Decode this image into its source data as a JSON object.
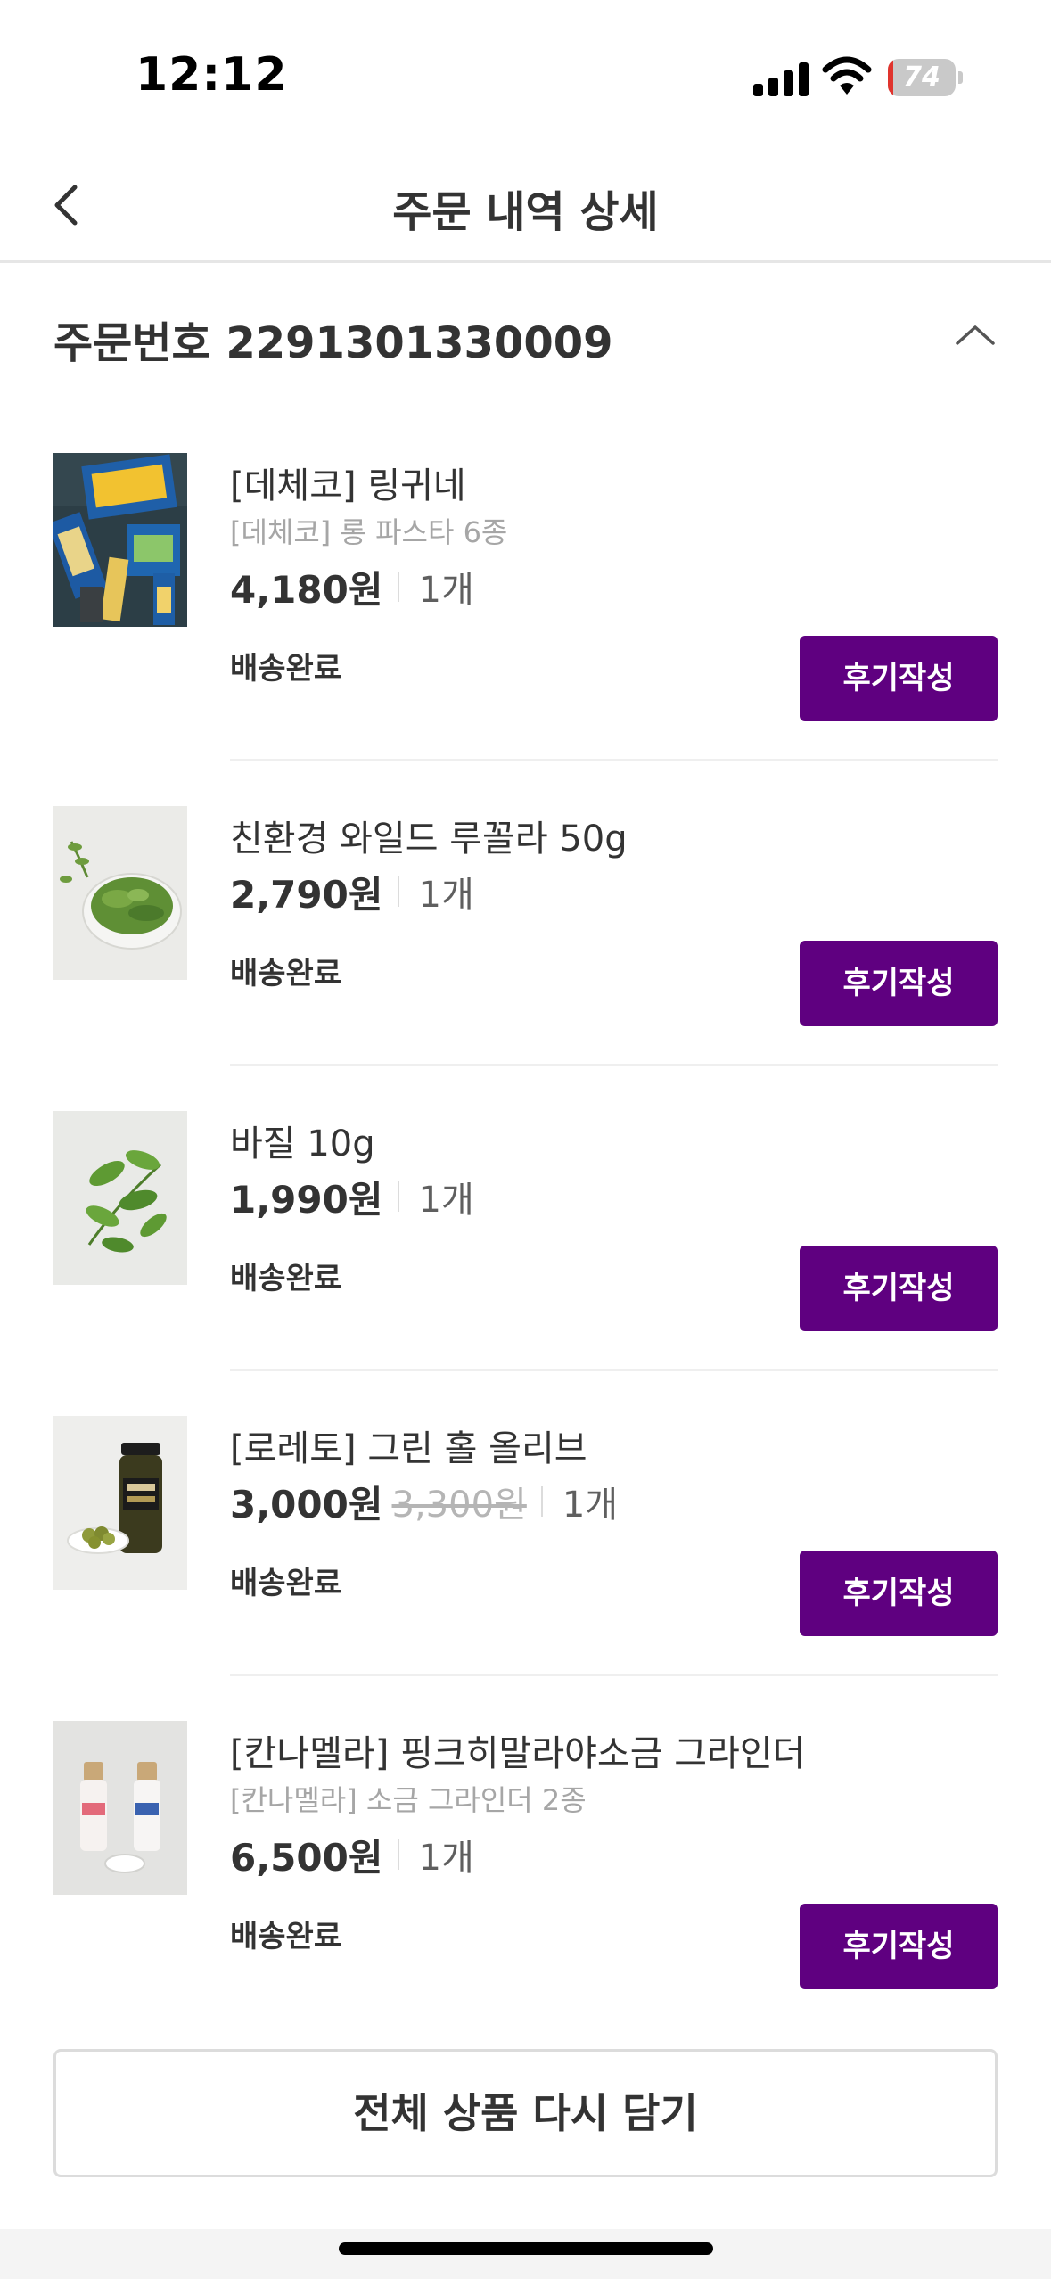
{
  "status_bar": {
    "time": "12:12",
    "battery_level": "74"
  },
  "nav": {
    "title": "주문 내역 상세"
  },
  "order": {
    "label": "주문번호 2291301330009"
  },
  "items": [
    {
      "name": "[데체코] 링귀네",
      "subtitle": "[데체코] 롱 파스타 6종",
      "price": "4,180원",
      "original_price": "",
      "qty": "1개",
      "status": "배송완료",
      "button": "후기작성",
      "thumb": "pasta-thumbnail"
    },
    {
      "name": "친환경 와일드 루꼴라 50g",
      "subtitle": "",
      "price": "2,790원",
      "original_price": "",
      "qty": "1개",
      "status": "배송완료",
      "button": "후기작성",
      "thumb": "arugula-thumbnail"
    },
    {
      "name": "바질 10g",
      "subtitle": "",
      "price": "1,990원",
      "original_price": "",
      "qty": "1개",
      "status": "배송완료",
      "button": "후기작성",
      "thumb": "basil-thumbnail"
    },
    {
      "name": "[로레토] 그린 홀 올리브",
      "subtitle": "",
      "price": "3,000원",
      "original_price": "3,300원",
      "qty": "1개",
      "status": "배송완료",
      "button": "후기작성",
      "thumb": "olive-thumbnail"
    },
    {
      "name": "[칸나멜라] 핑크히말라야소금 그라인더",
      "subtitle": "[칸나멜라] 소금 그라인더 2종",
      "price": "6,500원",
      "original_price": "",
      "qty": "1개",
      "status": "배송완료",
      "button": "후기작성",
      "thumb": "salt-grinder-thumbnail"
    }
  ],
  "footer": {
    "reorder_button": "전체 상품 다시 담기"
  },
  "colors": {
    "accent": "#5f0080",
    "text": "#333333",
    "muted": "#a6a6a6"
  }
}
